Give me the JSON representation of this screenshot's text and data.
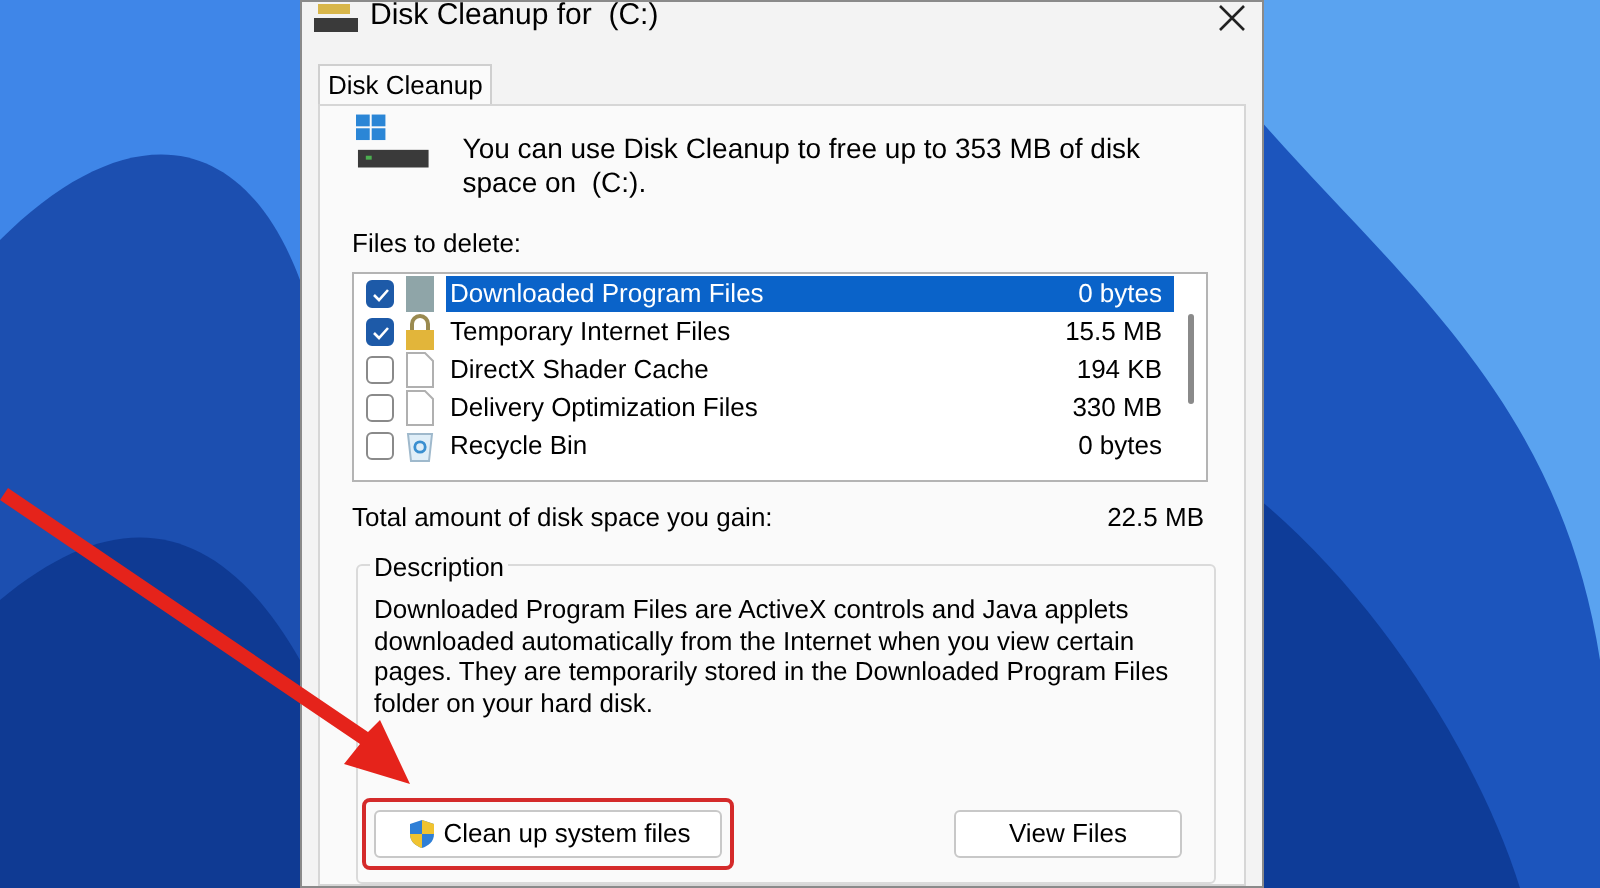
{
  "window": {
    "title": "Disk Cleanup for  (C:)"
  },
  "tabs": [
    {
      "label": "Disk Cleanup",
      "selected": true
    }
  ],
  "intro": "You can use Disk Cleanup to free up to 353 MB of disk space on  (C:).",
  "files_label": "Files to delete:",
  "files": [
    {
      "kind": "blank",
      "name": "Downloaded Program Files",
      "size": "0 bytes",
      "checked": true,
      "selected": true
    },
    {
      "kind": "lock",
      "name": "Temporary Internet Files",
      "size": "15.5 MB",
      "checked": true,
      "selected": false
    },
    {
      "kind": "file",
      "name": "DirectX Shader Cache",
      "size": "194 KB",
      "checked": false,
      "selected": false
    },
    {
      "kind": "file",
      "name": "Delivery Optimization Files",
      "size": "330 MB",
      "checked": false,
      "selected": false
    },
    {
      "kind": "recycle",
      "name": "Recycle Bin",
      "size": "0 bytes",
      "checked": false,
      "selected": false
    }
  ],
  "total": {
    "label": "Total amount of disk space you gain:",
    "value": "22.5 MB"
  },
  "description": {
    "title": "Description",
    "text": "Downloaded Program Files are ActiveX controls and Java applets downloaded automatically from the Internet when you view certain pages. They are temporarily stored in the Downloaded Program Files folder on your hard disk."
  },
  "buttons": [
    {
      "label": "Clean up system files",
      "kind": "shield",
      "highlighted": true
    },
    {
      "label": "View Files",
      "kind": "plain",
      "highlighted": false
    }
  ]
}
